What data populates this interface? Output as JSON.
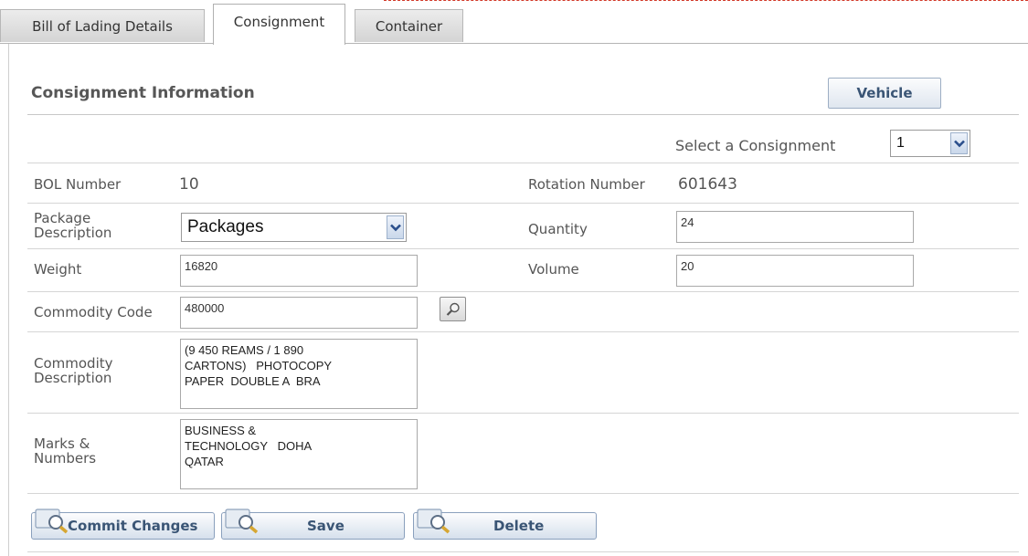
{
  "tabs": [
    {
      "label": "Bill of Lading Details"
    },
    {
      "label": "Consignment"
    },
    {
      "label": "Container"
    }
  ],
  "section": {
    "title": "Consignment Information",
    "vehicle_button": "Vehicle"
  },
  "consignment_select": {
    "label": "Select a Consignment",
    "value": "1"
  },
  "fields": {
    "bol_number": {
      "label": "BOL Number",
      "value": "10"
    },
    "rotation_number": {
      "label": "Rotation Number",
      "value": "601643"
    },
    "package_description": {
      "label_line1": "Package",
      "label_line2": "Description",
      "value": "Packages"
    },
    "quantity": {
      "label": "Quantity",
      "value": "24"
    },
    "weight": {
      "label": "Weight",
      "value": "16820"
    },
    "volume": {
      "label": "Volume",
      "value": "20"
    },
    "commodity_code": {
      "label": "Commodity Code",
      "value": "480000"
    },
    "commodity_description": {
      "label_line1": "Commodity",
      "label_line2": "Description",
      "value": "(9 450 REAMS / 1 890\nCARTONS)   PHOTOCOPY\nPAPER  DOUBLE A  BRA"
    },
    "marks_numbers": {
      "label_line1": "Marks &",
      "label_line2": "Numbers",
      "value": "BUSINESS &\nTECHNOLOGY   DOHA\nQATAR"
    }
  },
  "actions": {
    "commit": "Commit Changes",
    "save": "Save",
    "delete": "Delete"
  },
  "icons": {
    "select_arrow": "chevron-down-icon",
    "lookup": "magnifier-icon",
    "action": "magnifier-icon"
  },
  "colors": {
    "button_text": "#3a5575",
    "label_text": "#555555",
    "arrow_icon": "#2b4f8c"
  }
}
